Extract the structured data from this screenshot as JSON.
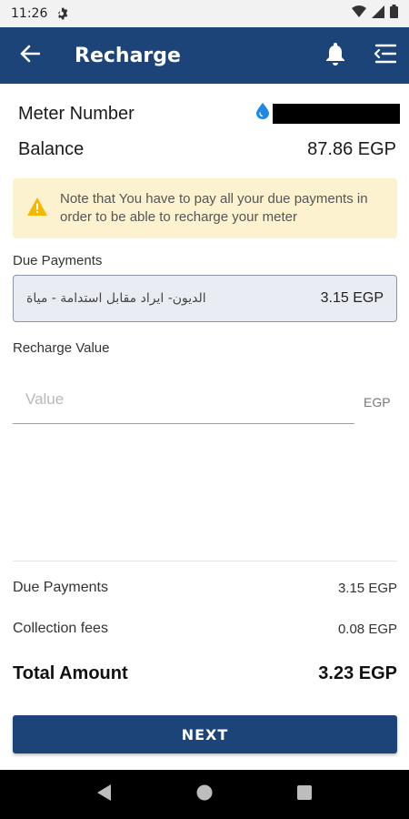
{
  "status_bar": {
    "time": "11:26",
    "icons": [
      "gear-icon",
      "wifi-icon",
      "signal-icon",
      "battery-icon"
    ]
  },
  "app_bar": {
    "title": "Recharge",
    "icons": [
      "back-arrow-icon",
      "bell-icon",
      "menu-icon"
    ]
  },
  "meter": {
    "label": "Meter Number",
    "icon": "water-drop-icon"
  },
  "balance": {
    "label": "Balance",
    "value": "87.86 EGP"
  },
  "notice": {
    "icon": "warning-icon",
    "text": "Note that You have to pay all your due payments in order to be able to recharge your meter"
  },
  "due_payments": {
    "label": "Due Payments",
    "description": "الديون- ايراد مقابل استدامة - مياة",
    "amount": "3.15 EGP"
  },
  "recharge": {
    "label": "Recharge Value",
    "placeholder": "Value",
    "currency": "EGP"
  },
  "summary": {
    "due_label": "Due Payments",
    "due_value": "3.15 EGP",
    "fees_label": "Collection fees",
    "fees_value": "0.08 EGP",
    "total_label": "Total Amount",
    "total_value": "3.23 EGP"
  },
  "next_button": "NEXT",
  "colors": {
    "primary": "#1d4478",
    "notice_bg": "#fdf2cf",
    "warning": "#f5b800",
    "drop": "#1e88e5"
  }
}
